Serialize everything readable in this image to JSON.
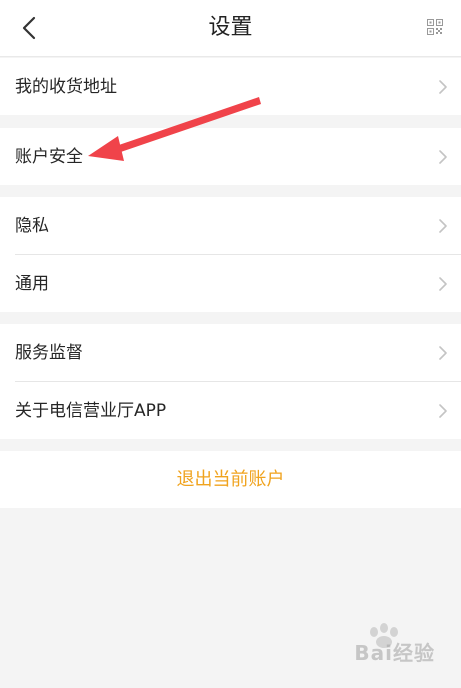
{
  "header": {
    "title": "设置"
  },
  "groups": [
    {
      "items": [
        {
          "label": "我的收货地址"
        }
      ]
    },
    {
      "items": [
        {
          "label": "账户安全"
        }
      ]
    },
    {
      "items": [
        {
          "label": "隐私"
        },
        {
          "label": "通用"
        }
      ]
    },
    {
      "items": [
        {
          "label": "服务监督"
        },
        {
          "label": "关于电信营业厅APP"
        }
      ]
    }
  ],
  "logout": {
    "label": "退出当前账户"
  },
  "watermark": {
    "text": "Bai经验"
  },
  "colors": {
    "accent": "#f0a31e",
    "annotation_arrow": "#f0434a"
  },
  "icons": {
    "back": "chevron-left-icon",
    "qr": "qr-code-icon",
    "row": "chevron-right-icon"
  }
}
